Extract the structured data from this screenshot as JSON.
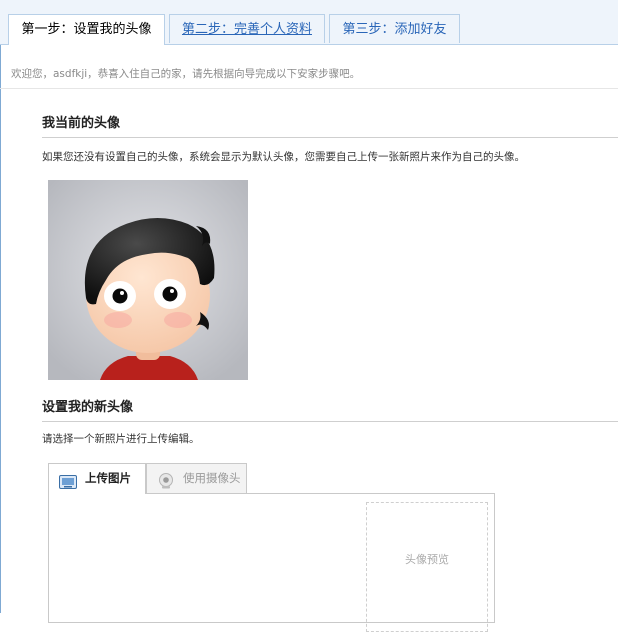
{
  "tabs": [
    {
      "label": "第一步：设置我的头像",
      "active": true
    },
    {
      "label": "第二步：完善个人资料",
      "active": false
    },
    {
      "label": "第三步：添加好友",
      "active": false
    }
  ],
  "welcome_text": "欢迎您，asdfkji，恭喜入住自己的家，请先根据向导完成以下安家步骤吧。",
  "current_avatar": {
    "title": "我当前的头像",
    "description": "如果您还没有设置自己的头像，系统会显示为默认头像，您需要自己上传一张新照片来作为自己的头像。"
  },
  "new_avatar": {
    "title": "设置我的新头像",
    "description": "请选择一个新照片进行上传编辑。"
  },
  "upload": {
    "tabs": [
      {
        "label": "上传图片",
        "icon": "picture-icon",
        "active": true
      },
      {
        "label": "使用摄像头",
        "icon": "webcam-icon",
        "active": false
      }
    ],
    "preview_label": "头像预览"
  },
  "colors": {
    "tab_bar_bg": "#eef4fb",
    "tab_border": "#b8d0e8",
    "link": "#2a66b8",
    "avatar_bg": "#c5c7cc"
  }
}
